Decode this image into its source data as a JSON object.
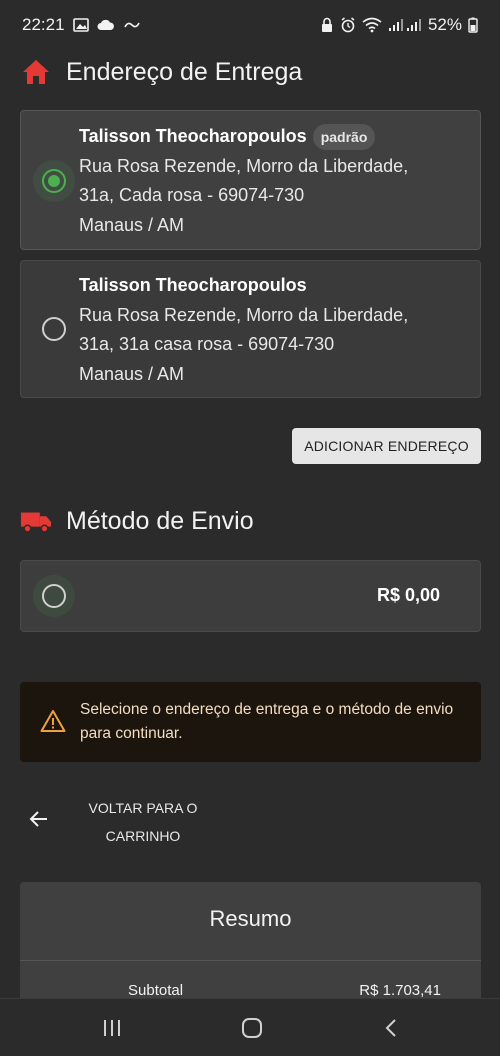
{
  "status_bar": {
    "time": "22:21",
    "battery": "52%",
    "icons": [
      "image-icon",
      "cloud-icon",
      "carrier-icon",
      "lock-icon",
      "alarm-icon",
      "wifi-icon",
      "signal-icon",
      "battery-icon"
    ]
  },
  "delivery": {
    "title": "Endereço de Entrega",
    "icon": "home-icon",
    "addresses": [
      {
        "name": "Talisson Theocharopoulos",
        "badge": "padrão",
        "line1": "Rua Rosa Rezende, Morro da Liberdade,",
        "line2": "31a, Cada rosa - 69074-730",
        "line3": "Manaus / AM",
        "selected": true
      },
      {
        "name": "Talisson Theocharopoulos",
        "line1": "Rua Rosa Rezende, Morro da Liberdade,",
        "line2": "31a, 31a casa rosa - 69074-730",
        "line3": "Manaus / AM",
        "selected": false
      }
    ],
    "add_button": "ADICIONAR ENDEREÇO"
  },
  "shipping": {
    "title": "Método de Envio",
    "icon": "truck-icon",
    "option_price": "R$ 0,00"
  },
  "alert": {
    "icon": "warning-icon",
    "message": "Selecione o endereço de entrega e o método de envio para continuar."
  },
  "back_link": {
    "line1": "VOLTAR PARA O",
    "line2": "CARRINHO"
  },
  "summary": {
    "title": "Resumo",
    "subtotal_label": "Subtotal",
    "subtotal_value": "R$ 1.703,41"
  },
  "colors": {
    "accent_red": "#e53935",
    "selected_green": "#4caf50",
    "background": "#2b2b2b"
  }
}
